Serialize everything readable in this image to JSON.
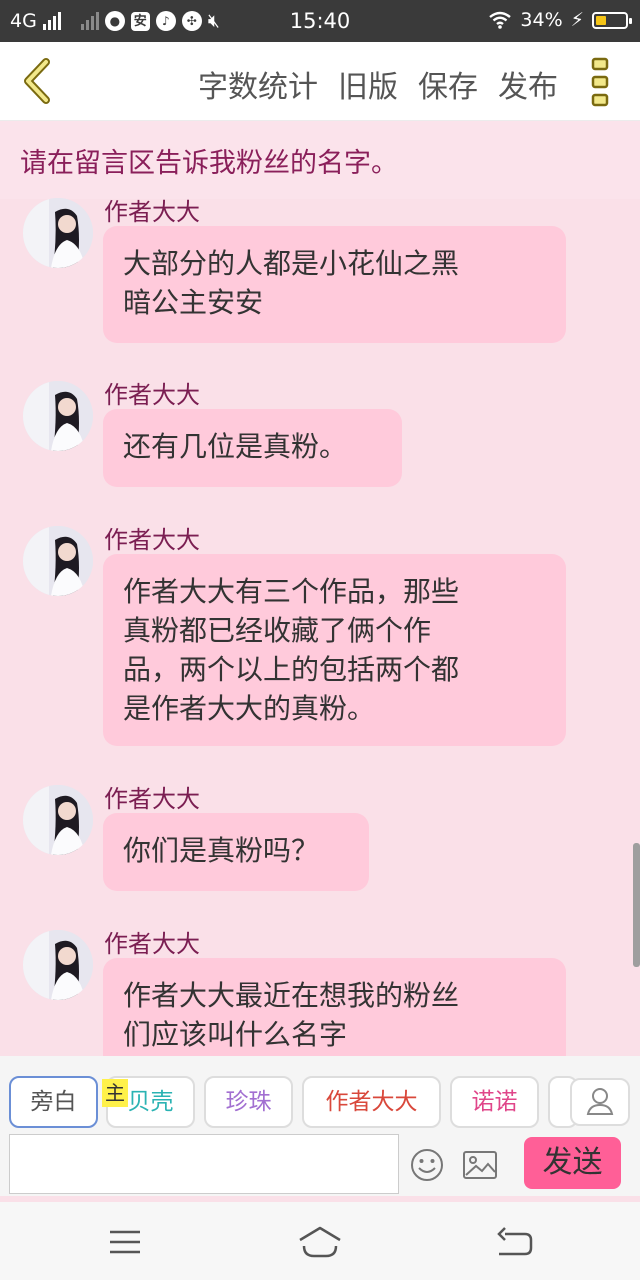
{
  "status_bar": {
    "network": "4G",
    "time": "15:40",
    "battery_percent": "34%",
    "battery_level": 0.34
  },
  "app_bar": {
    "actions": [
      "字数统计",
      "旧版",
      "保存",
      "发布"
    ]
  },
  "notice": "请在留言区告诉我粉丝的名字。",
  "messages": [
    {
      "speaker": "作者大大",
      "lines": [
        "大部分的人都是小花仙之黑",
        "暗公主安安"
      ]
    },
    {
      "speaker": "作者大大",
      "lines": [
        "还有几位是真粉。"
      ]
    },
    {
      "speaker": "作者大大",
      "lines": [
        "作者大大有三个作品，那些",
        "真粉都已经收藏了俩个作",
        "品，两个以上的包括两个都",
        "是作者大大的真粉。"
      ]
    },
    {
      "speaker": "作者大大",
      "lines": [
        "你们是真粉吗？"
      ]
    },
    {
      "speaker": "作者大大",
      "lines": [
        "作者大大最近在想我的粉丝",
        "们应该叫什么名字"
      ]
    }
  ],
  "characters": [
    {
      "label": "旁白",
      "color": "#555555"
    },
    {
      "label": "贝壳",
      "color": "#2bb3b3"
    },
    {
      "label": "珍珠",
      "color": "#a26fd1"
    },
    {
      "label": "作者大大",
      "color": "#d9483b"
    },
    {
      "label": "诺诺",
      "color": "#e0468a"
    }
  ],
  "main_tag": "主",
  "composer": {
    "input_value": "",
    "send_label": "发送"
  },
  "colors": {
    "accent": "#ff5f97",
    "bubble": "#ffcadb",
    "content_bg": "#fae0e8",
    "speaker": "#7b1e52"
  }
}
